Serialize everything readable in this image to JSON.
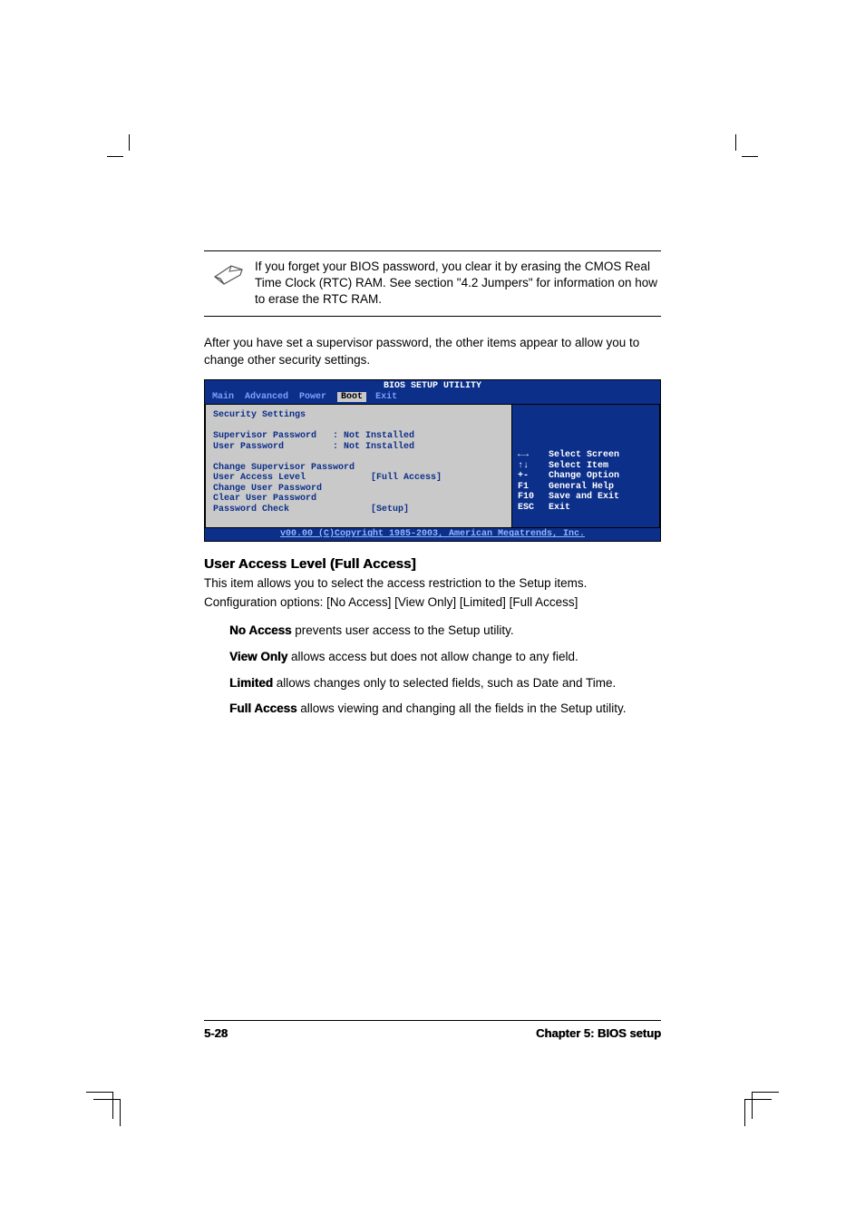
{
  "note": {
    "text": "If you forget your BIOS password, you clear it by erasing the CMOS Real Time Clock (RTC) RAM. See section \"4.2 Jumpers\" for information on how to erase the RTC RAM."
  },
  "intro": "After you have set a supervisor password, the other items appear to allow you to change other security settings.",
  "bios": {
    "title": "BIOS SETUP UTILITY",
    "menu": [
      "Main",
      "Advanced",
      "Power",
      "Boot",
      "Exit"
    ],
    "menu_selected": "Boot",
    "left_heading": "Security Settings",
    "rows": {
      "sup_label": "Supervisor Password",
      "sup_val": ": Not Installed",
      "usr_label": "User Password",
      "usr_val": ": Not Installed",
      "r1": "Change Supervisor Password",
      "r2_label": "User Access Level",
      "r2_val": "[Full Access]",
      "r3": "Change User Password",
      "r4": "Clear User Password",
      "r5_label": "Password Check",
      "r5_val": "[Setup]"
    },
    "help": [
      {
        "key": "←→",
        "txt": "Select Screen"
      },
      {
        "key": "↑↓",
        "txt": "Select Item"
      },
      {
        "key": "+-",
        "txt": "Change Option"
      },
      {
        "key": "F1",
        "txt": "General Help"
      },
      {
        "key": "F10",
        "txt": "Save and Exit"
      },
      {
        "key": "ESC",
        "txt": "Exit"
      }
    ],
    "footer": "v00.00 (C)Copyright 1985-2003, American Megatrends, Inc."
  },
  "section_heading": "User Access Level (Full Access]",
  "section_p1": "This item allows you to select the access restriction to the Setup items.",
  "section_p2": "Configuration options: [No Access] [View Only] [Limited] [Full Access]",
  "options": {
    "no_access_b": "No Access",
    "no_access_t": " prevents user access to the Setup utility.",
    "view_only_b": "View Only",
    "view_only_t": " allows access but does not allow change to any field.",
    "limited_b": "Limited",
    "limited_t": " allows changes only to selected fields, such as Date and Time.",
    "full_access_b": "Full Access",
    "full_access_t": " allows viewing and changing all the fields in the Setup utility."
  },
  "footer": {
    "left": "5-28",
    "right": "Chapter 5: BIOS setup"
  }
}
